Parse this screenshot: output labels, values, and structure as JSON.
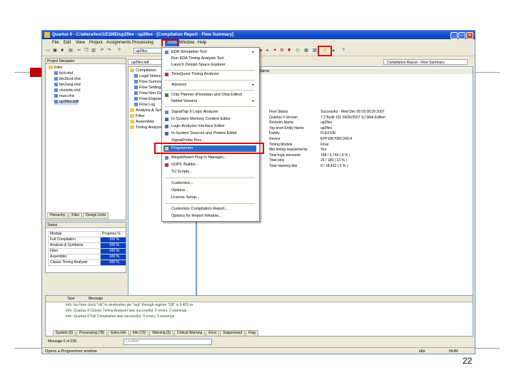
{
  "window": {
    "title": "Quartus II - C:/altera/test1/ESMD/up2flex - up2flex - [Compilation Report - Flow Summary]",
    "minimize": "_",
    "maximize": "□",
    "close": "×"
  },
  "menubar": {
    "items": [
      "File",
      "Edit",
      "View",
      "Project",
      "Assignments",
      "Processing",
      "Tools",
      "Window",
      "Help"
    ]
  },
  "toolbar": {
    "combo_value": "up2flex"
  },
  "project_navigator": {
    "title": "Project Navigator",
    "items": [
      "Files",
      "bcd.vhd",
      "bin2bcd.vhd",
      "bin2seg.vhd",
      "clockdiv.vhd",
      "mux.vhd",
      "up2flex.bdf"
    ],
    "tabs": [
      "Hierarchy",
      "Files",
      "Design Units"
    ]
  },
  "status_panel": {
    "title": "Status",
    "headers": [
      "Module",
      "Progress %"
    ],
    "rows": [
      {
        "module": "Full Compilation",
        "progress": "100 %"
      },
      {
        "module": "Analysis & Synthesis",
        "progress": "100 %"
      },
      {
        "module": "Fitter",
        "progress": "100 %"
      },
      {
        "module": "Assembler",
        "progress": "100 %"
      },
      {
        "module": "Classic Timing Analyzer",
        "progress": "100 %"
      }
    ]
  },
  "report_tree": {
    "doc_tab": "up2flex.bdf",
    "items": [
      "Compilation",
      "Legal Notice",
      "Flow Summary",
      "Flow Settings",
      "Flow Non-Default",
      "Flow Elapsed Time",
      "Flow Log",
      "Analysis & Synthesis",
      "Fitter",
      "Assembler",
      "Timing Analyzer"
    ]
  },
  "tools_menu": {
    "items": [
      {
        "label": "EDA Simulation Tool",
        "arrow": "▸"
      },
      {
        "label": "Run EDA Timing Analysis Tool",
        "arrow": ""
      },
      {
        "label": "Launch Design Space Explorer",
        "arrow": ""
      },
      {
        "label": "TimeQuest Timing Analyzer",
        "arrow": ""
      },
      {
        "label": "Advisors",
        "arrow": "▸"
      },
      {
        "label": "Chip Planner (Floorplan and Chip Editor)",
        "arrow": ""
      },
      {
        "label": "Netlist Viewers",
        "arrow": "▸"
      },
      {
        "label": "SignalTap II Logic Analyzer",
        "arrow": ""
      },
      {
        "label": "In-System Memory Content Editor",
        "arrow": ""
      },
      {
        "label": "Logic Analyzer Interface Editor",
        "arrow": ""
      },
      {
        "label": "In-System Sources and Probes Editor",
        "arrow": ""
      },
      {
        "label": "SignalProbe Pins...",
        "arrow": ""
      },
      {
        "label": "Programmer",
        "arrow": ""
      },
      {
        "label": "MegaWizard Plug-In Manager...",
        "arrow": ""
      },
      {
        "label": "SOPC Builder...",
        "arrow": ""
      },
      {
        "label": "Tcl Scripts...",
        "arrow": ""
      },
      {
        "label": "Customize...",
        "arrow": ""
      },
      {
        "label": "Options...",
        "arrow": ""
      },
      {
        "label": "License Setup...",
        "arrow": ""
      },
      {
        "label": "Customize Compilation Report...",
        "arrow": ""
      },
      {
        "label": "Options for Report Window...",
        "arrow": ""
      }
    ]
  },
  "report": {
    "tab_label": "Compilation Report - Flow Summary",
    "name_header": "Name",
    "summary": [
      {
        "k": "Flow Status",
        "v": "Successful - Wed Dec 05 09:28:39 2007"
      },
      {
        "k": "Quartus II Version",
        "v": "7.2 Build 151 09/26/2007 SJ Web Edition"
      },
      {
        "k": "Revision Name",
        "v": "up2flex"
      },
      {
        "k": "Top-level Entity Name",
        "v": "up2flex"
      },
      {
        "k": "Family",
        "v": "FLEX10K"
      },
      {
        "k": "Device",
        "v": "EPF10K70RC240-4"
      },
      {
        "k": "Timing Models",
        "v": "Final"
      },
      {
        "k": "Met timing requirements",
        "v": "Yes"
      },
      {
        "k": "Total logic elements",
        "v": "168 / 3,744 ( 4 % )"
      },
      {
        "k": "Total pins",
        "v": "25 / 189 ( 13 % )"
      },
      {
        "k": "Total memory bits",
        "v": "0 / 18,432 ( 0 % )"
      }
    ]
  },
  "messages": {
    "header_type": "Type",
    "header_message": "Message",
    "lines": [
      "Info: tco from clock \"clk\" to destination pin \"seg\" through register \"Q8\" is 9.403 ns",
      "Info: Quartus II Classic Timing Analyzer was successful. 0 errors, 2 warnings",
      "Info: Quartus II Full Compilation was successful. 0 errors, 5 warnings"
    ],
    "tabs": [
      "System (5)",
      "Processing (78)",
      "Extra Info",
      "Info (73)",
      "Warning (5)",
      "Critical Warning",
      "Error",
      "Suppressed",
      "Flag"
    ],
    "count": "Message 0 of 238",
    "location_placeholder": "Location"
  },
  "statusbar": {
    "left": "Opens a Programmer window",
    "mode": "idle",
    "num": "NUM"
  },
  "slide": {
    "page_number": "22"
  }
}
